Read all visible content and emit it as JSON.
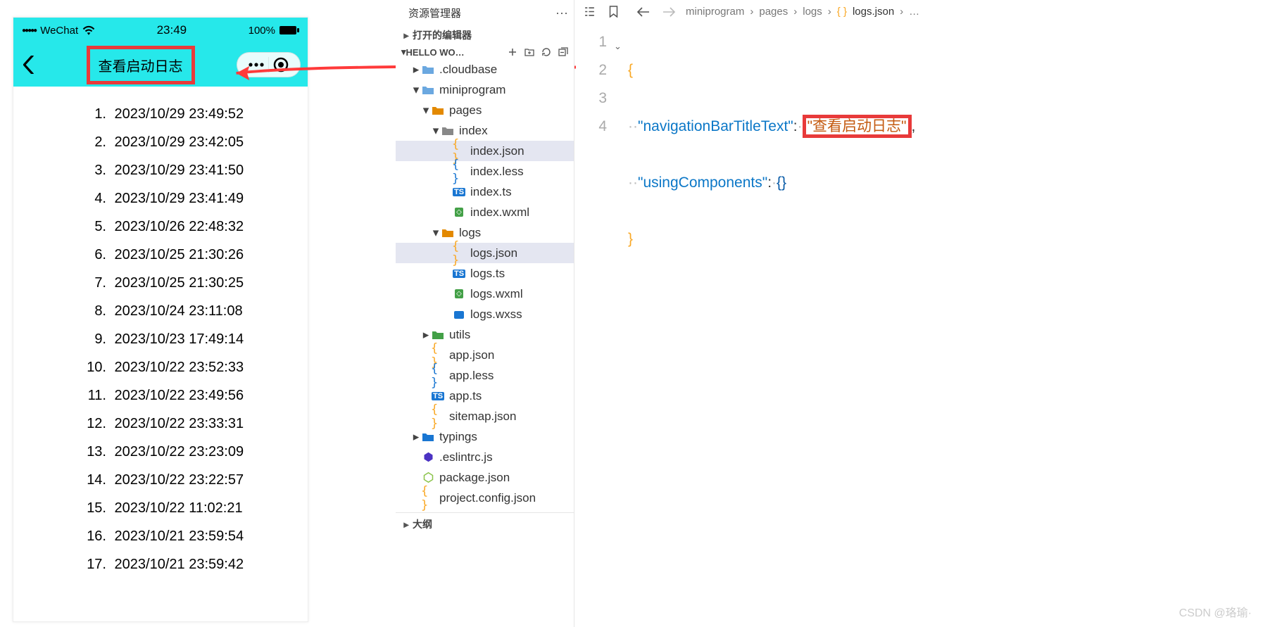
{
  "simulator": {
    "statusbar": {
      "carrier": "WeChat",
      "time": "23:49",
      "battery": "100%"
    },
    "nav": {
      "title": "查看启动日志"
    },
    "logs": [
      "2023/10/29 23:49:52",
      "2023/10/29 23:42:05",
      "2023/10/29 23:41:50",
      "2023/10/29 23:41:49",
      "2023/10/26 22:48:32",
      "2023/10/25 21:30:26",
      "2023/10/25 21:30:25",
      "2023/10/24 23:11:08",
      "2023/10/23 17:49:14",
      "2023/10/22 23:52:33",
      "2023/10/22 23:49:56",
      "2023/10/22 23:33:31",
      "2023/10/22 23:23:09",
      "2023/10/22 23:22:57",
      "2023/10/22 11:02:21",
      "2023/10/21 23:59:54",
      "2023/10/21 23:59:42"
    ]
  },
  "explorer": {
    "title": "资源管理器",
    "open_editors": "打开的编辑器",
    "project": "HELLO WO…",
    "outline": "大纲",
    "tree": {
      "cloudbase": ".cloudbase",
      "miniprogram": "miniprogram",
      "pages": "pages",
      "index": "index",
      "index_json": "index.json",
      "index_less": "index.less",
      "index_ts": "index.ts",
      "index_wxml": "index.wxml",
      "logs": "logs",
      "logs_json": "logs.json",
      "logs_ts": "logs.ts",
      "logs_wxml": "logs.wxml",
      "logs_wxss": "logs.wxss",
      "utils": "utils",
      "app_json": "app.json",
      "app_less": "app.less",
      "app_ts": "app.ts",
      "sitemap": "sitemap.json",
      "typings": "typings",
      "eslintrc": ".eslintrc.js",
      "package": "package.json",
      "projectconfig": "project.config.json"
    }
  },
  "breadcrumb": {
    "p0": "miniprogram",
    "p1": "pages",
    "p2": "logs",
    "p3": "logs.json",
    "ellipsis": "…"
  },
  "code": {
    "line1": "{",
    "line2_key": "\"navigationBarTitleText\"",
    "line2_val": "\"查看启动日志\"",
    "line3_key": "\"usingComponents\"",
    "line3_val": "{}",
    "line4": "}"
  },
  "watermark": "CSDN @珞瑜·"
}
